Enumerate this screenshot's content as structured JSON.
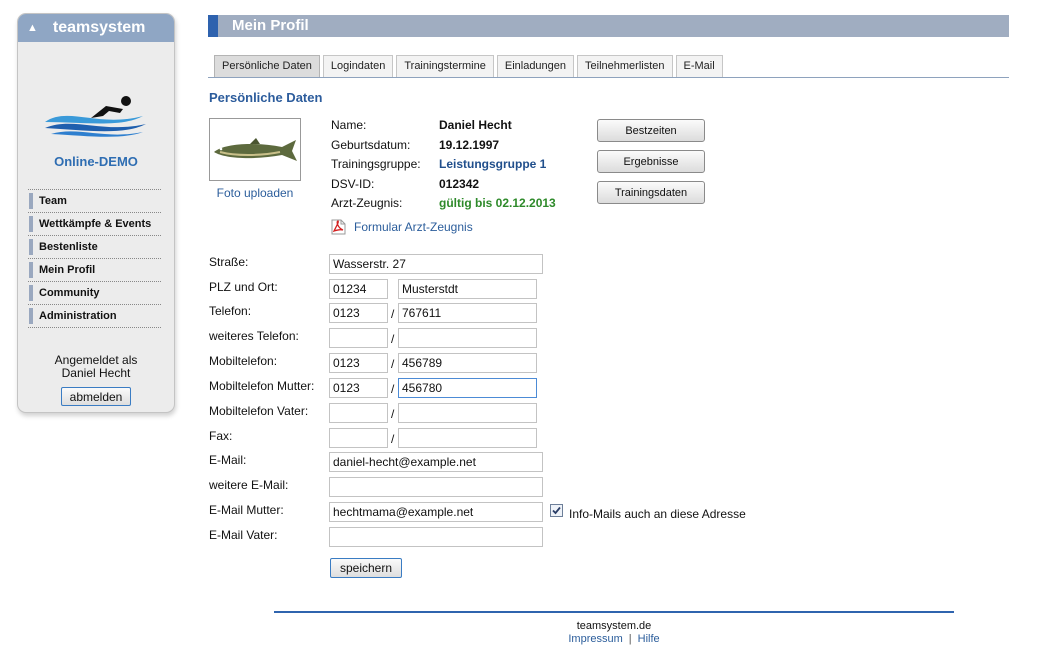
{
  "sidebar": {
    "title": "teamsystem",
    "brand": "Online-DEMO",
    "nav": [
      "Team",
      "Wettkämpfe & Events",
      "Bestenliste",
      "Mein Profil",
      "Community",
      "Administration"
    ],
    "logged_in_line1": "Angemeldet als",
    "logged_in_name": "Daniel Hecht",
    "logout_label": "abmelden"
  },
  "page": {
    "title": "Mein Profil",
    "tabs": [
      "Persönliche Daten",
      "Logindaten",
      "Trainingstermine",
      "Einladungen",
      "Teilnehmerlisten",
      "E-Mail"
    ],
    "active_tab": "Persönliche Daten",
    "section_title": "Persönliche Daten",
    "photo_upload": "Foto uploaden"
  },
  "profile": {
    "labels": {
      "name": "Name:",
      "birthdate": "Geburtsdatum:",
      "group": "Trainingsgruppe:",
      "dsv": "DSV-ID:",
      "doctor": "Arzt-Zeugnis:"
    },
    "name": "Daniel Hecht",
    "birthdate": "19.12.1997",
    "group": "Leistungsgruppe 1",
    "dsv_id": "012342",
    "doctor_cert": "gültig bis 02.12.2013",
    "form_link": "Formular Arzt-Zeugnis"
  },
  "buttons": {
    "best_times": "Bestzeiten",
    "results": "Ergebnisse",
    "training_data": "Trainingsdaten",
    "save": "speichern"
  },
  "form": {
    "labels": {
      "street": "Straße:",
      "zip_city": "PLZ und Ort:",
      "phone": "Telefon:",
      "phone2": "weiteres Telefon:",
      "mobile": "Mobiltelefon:",
      "mobile_mother": "Mobiltelefon Mutter:",
      "mobile_father": "Mobiltelefon Vater:",
      "fax": "Fax:",
      "email": "E-Mail:",
      "email2": "weitere E-Mail:",
      "email_mother": "E-Mail Mutter:",
      "email_father": "E-Mail Vater:"
    },
    "separator": "/",
    "street": "Wasserstr. 27",
    "zip": "01234",
    "city": "Musterstdt",
    "phone_area": "0123",
    "phone_number": "767611",
    "phone2_area": "",
    "phone2_number": "",
    "mobile_area": "0123",
    "mobile_number": "456789",
    "mobile_mother_area": "0123",
    "mobile_mother_number": "456780",
    "mobile_father_area": "",
    "mobile_father_number": "",
    "fax_area": "",
    "fax_number": "",
    "email": "daniel-hecht@example.net",
    "email2": "",
    "email_mother": "hechtmama@example.net",
    "email_father": "",
    "info_mail_label": "Info-Mails auch an diese Adresse",
    "info_mail_checked": true
  },
  "footer": {
    "site": "teamsystem.de",
    "impressum": "Impressum",
    "separator": "|",
    "help": "Hilfe"
  },
  "colors": {
    "header_bar": "#a0adc1",
    "header_accent": "#2e62ae",
    "link_blue": "#2b5d9b",
    "valid_green": "#2e8a2a"
  }
}
